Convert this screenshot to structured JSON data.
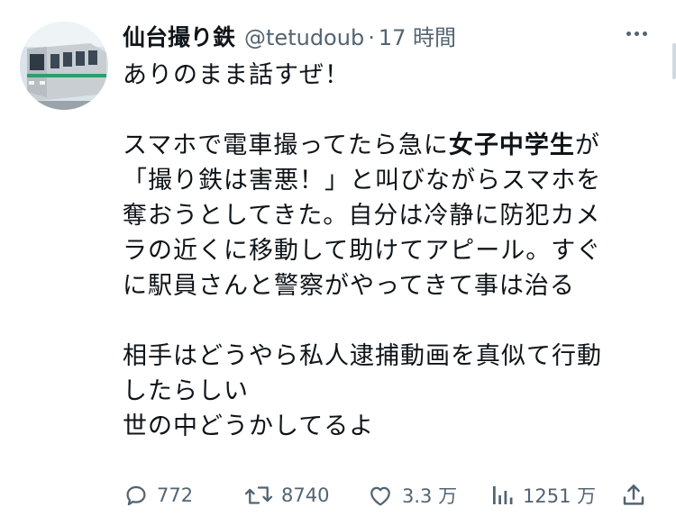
{
  "author": {
    "name": "仙台撮り鉄",
    "handle": "@tetudoub",
    "separator": "·",
    "time": "17 時間"
  },
  "tweet": {
    "lines": [
      "ありのまま話すぜ！",
      "",
      "スマホで電車撮ってたら急に",
      "女子中学生",
      "が",
      "「撮り鉄は害悪！」と叫びながらスマホを",
      "奪おうとしてきた。自分は冷静に防犯カメ",
      "ラの近くに移動して助けてアピール。すぐ",
      "に駅員さんと警察がやってきて事は治る",
      "",
      "相手はどうやら私人逮捕動画を真似て行動",
      "したらしい",
      "世の中どうかしてるよ"
    ]
  },
  "actions": {
    "reply_count": "772",
    "retweet_count": "8740",
    "like_count": "3.3 万",
    "views_count": "1251 万"
  },
  "icons": {
    "reply": "reply-icon",
    "retweet": "retweet-icon",
    "like": "heart-icon",
    "views": "views-bar-chart-icon",
    "share": "share-icon",
    "more": "more-dots-icon"
  },
  "colors": {
    "text": "#0f1419",
    "secondary": "#536471"
  }
}
